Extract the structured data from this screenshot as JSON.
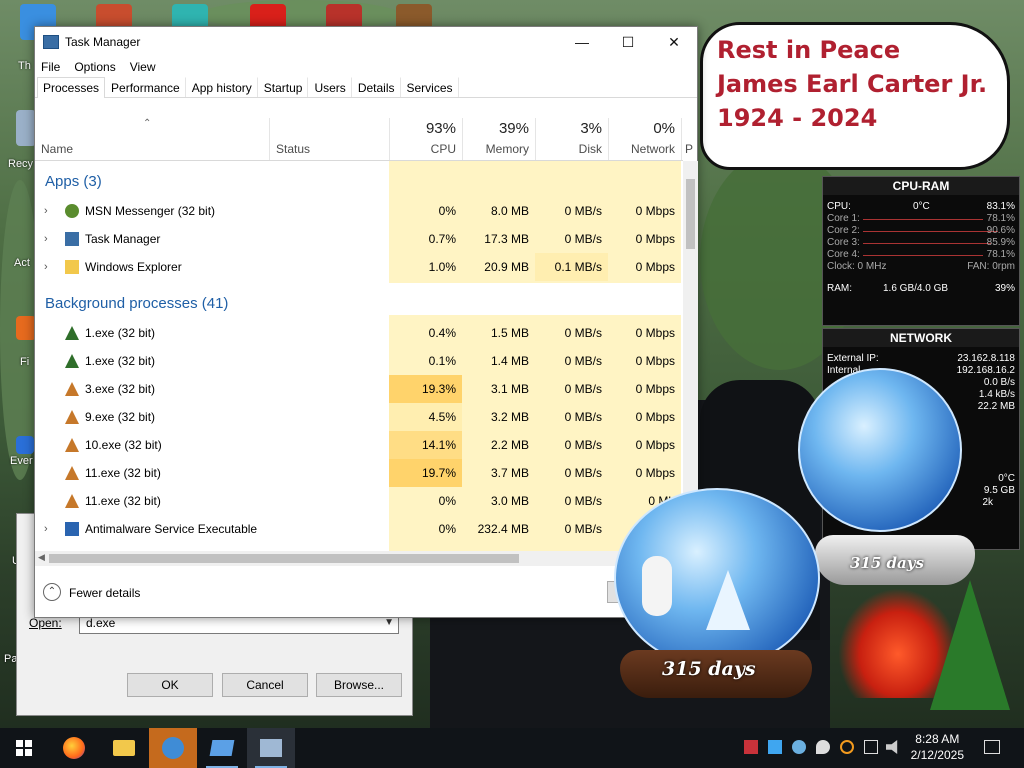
{
  "bubble": {
    "lines": [
      "Rest in Peace",
      "James Earl Carter Jr.",
      "1924 - 2024"
    ]
  },
  "desktop_icons": {
    "labels": [
      "Th",
      "Recy",
      "Act",
      "Fi",
      "Ever",
      "U",
      "Pa"
    ]
  },
  "task_manager": {
    "title": "Task Manager",
    "window_controls": {
      "minimize": "—",
      "maximize": "☐",
      "close": "✕"
    },
    "menu": [
      "File",
      "Options",
      "View"
    ],
    "tabs": [
      "Processes",
      "Performance",
      "App history",
      "Startup",
      "Users",
      "Details",
      "Services"
    ],
    "active_tab": "Processes",
    "columns": {
      "name": "Name",
      "status": "Status",
      "cpu": {
        "pct": "93%",
        "label": "CPU"
      },
      "memory": {
        "pct": "39%",
        "label": "Memory"
      },
      "disk": {
        "pct": "3%",
        "label": "Disk"
      },
      "network": {
        "pct": "0%",
        "label": "Network"
      },
      "power": "P"
    },
    "sections": {
      "apps": "Apps (3)",
      "background": "Background processes (41)"
    },
    "apps": [
      {
        "name": "MSN Messenger (32 bit)",
        "cpu": "0%",
        "memory": "8.0 MB",
        "disk": "0 MB/s",
        "network": "0 Mbps"
      },
      {
        "name": "Task Manager",
        "cpu": "0.7%",
        "memory": "17.3 MB",
        "disk": "0 MB/s",
        "network": "0 Mbps"
      },
      {
        "name": "Windows Explorer",
        "cpu": "1.0%",
        "memory": "20.9 MB",
        "disk": "0.1 MB/s",
        "network": "0 Mbps"
      }
    ],
    "background": [
      {
        "name": "1.exe (32 bit)",
        "cpu": "0.4%",
        "memory": "1.5 MB",
        "disk": "0 MB/s",
        "network": "0 Mbps"
      },
      {
        "name": "1.exe (32 bit)",
        "cpu": "0.1%",
        "memory": "1.4 MB",
        "disk": "0 MB/s",
        "network": "0 Mbps"
      },
      {
        "name": "3.exe (32 bit)",
        "cpu": "19.3%",
        "memory": "3.1 MB",
        "disk": "0 MB/s",
        "network": "0 Mbps"
      },
      {
        "name": "9.exe (32 bit)",
        "cpu": "4.5%",
        "memory": "3.2 MB",
        "disk": "0 MB/s",
        "network": "0 Mbps"
      },
      {
        "name": "10.exe (32 bit)",
        "cpu": "14.1%",
        "memory": "2.2 MB",
        "disk": "0 MB/s",
        "network": "0 Mbps"
      },
      {
        "name": "11.exe (32 bit)",
        "cpu": "19.7%",
        "memory": "3.7 MB",
        "disk": "0 MB/s",
        "network": "0 Mbps"
      },
      {
        "name": "11.exe (32 bit)",
        "cpu": "0%",
        "memory": "3.0 MB",
        "disk": "0 MB/s",
        "network": "0 Mb"
      },
      {
        "name": "Antimalware Service Executable",
        "cpu": "0%",
        "memory": "232.4 MB",
        "disk": "0 MB/s",
        "network": ""
      }
    ],
    "footer": {
      "fewer_details": "Fewer details"
    }
  },
  "run_dialog": {
    "open_label": "Open:",
    "input_value": "d.exe",
    "ok": "OK",
    "cancel": "Cancel",
    "browse": "Browse..."
  },
  "gadget_cpu": {
    "title": "CPU-RAM",
    "cpu_label": "CPU:",
    "cpu_temp": "0°C",
    "cpu_value": "83.1%",
    "cores": [
      {
        "label": "Core 1:",
        "value": "78.1%"
      },
      {
        "label": "Core 2:",
        "value": "90.6%"
      },
      {
        "label": "Core 3:",
        "value": "85.9%"
      },
      {
        "label": "Core 4:",
        "value": "78.1%"
      }
    ],
    "clock": "Clock: 0 MHz",
    "fan": "FAN: 0rpm",
    "ram_label": "RAM:",
    "ram_value": "1.6 GB/4.0 GB",
    "ram_pct": "39%"
  },
  "gadget_net": {
    "title": "NETWORK",
    "external_label": "External IP:",
    "external_ip": "23.162.8.118",
    "internal_label": "Internal",
    "internal_ip": "192.168.16.2",
    "rate1": "0.0 B/s",
    "rate2": "1.4 kB/s",
    "rate3": "22.2 MB"
  },
  "gadget_extra": {
    "temp": "0°C",
    "size": "9.5 GB",
    "k": "2k"
  },
  "globes": {
    "small_days": "315 days",
    "large_days": "315 days"
  },
  "taskbar": {
    "time": "8:28 AM",
    "date": "2/12/2025"
  }
}
